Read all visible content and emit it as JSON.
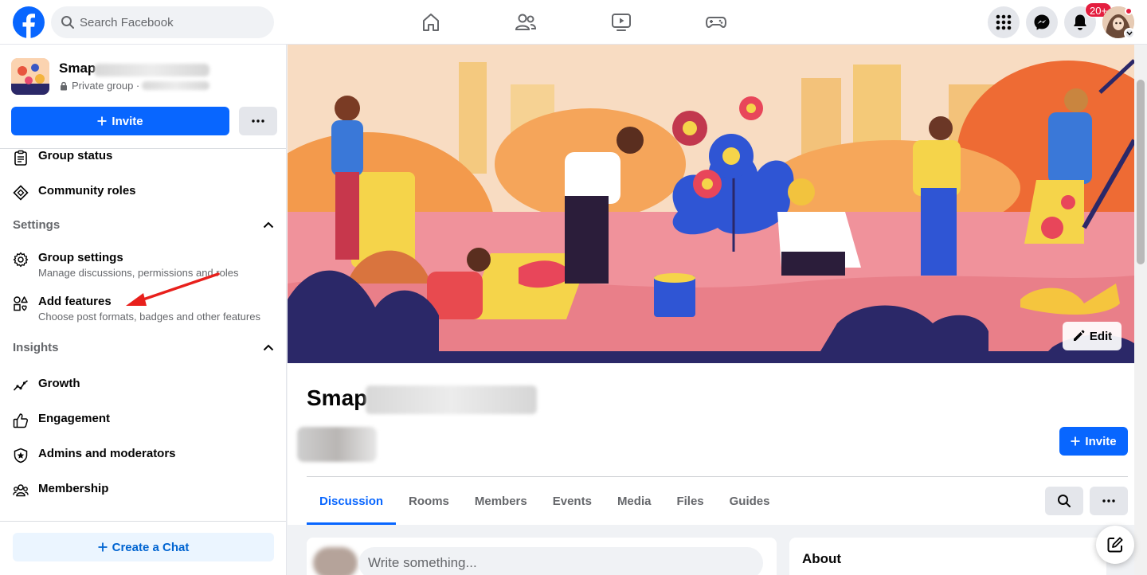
{
  "topbar": {
    "search_placeholder": "Search Facebook",
    "notification_count": "20+",
    "nav": [
      "home-icon",
      "friends-icon",
      "watch-icon",
      "gaming-icon"
    ]
  },
  "sidebar": {
    "group_name": "Smap",
    "privacy": "Private group ·",
    "invite_label": "Invite",
    "items_top": [
      {
        "label": "Group status",
        "icon": "clipboard-icon"
      },
      {
        "label": "Community roles",
        "icon": "diamond-icon"
      }
    ],
    "settings_header": "Settings",
    "settings_items": [
      {
        "label": "Group settings",
        "sub": "Manage discussions, permissions and roles",
        "icon": "gear-icon"
      },
      {
        "label": "Add features",
        "sub": "Choose post formats, badges and other features",
        "icon": "shapes-icon"
      }
    ],
    "insights_header": "Insights",
    "insights_items": [
      {
        "label": "Growth",
        "icon": "growth-icon"
      },
      {
        "label": "Engagement",
        "icon": "thumbs-up-icon"
      },
      {
        "label": "Admins and moderators",
        "icon": "shield-star-icon"
      },
      {
        "label": "Membership",
        "icon": "people-icon"
      }
    ],
    "create_chat": "Create a Chat"
  },
  "main": {
    "edit_label": "Edit",
    "group_title": "Smap",
    "invite_label": "Invite",
    "tabs": [
      "Discussion",
      "Rooms",
      "Members",
      "Events",
      "Media",
      "Files",
      "Guides"
    ],
    "active_tab": "Discussion",
    "compose_placeholder": "Write something...",
    "about_heading": "About"
  },
  "colors": {
    "brand_blue": "#0866ff",
    "badge_red": "#e41e3f",
    "annotation_arrow": "#e8201c"
  }
}
